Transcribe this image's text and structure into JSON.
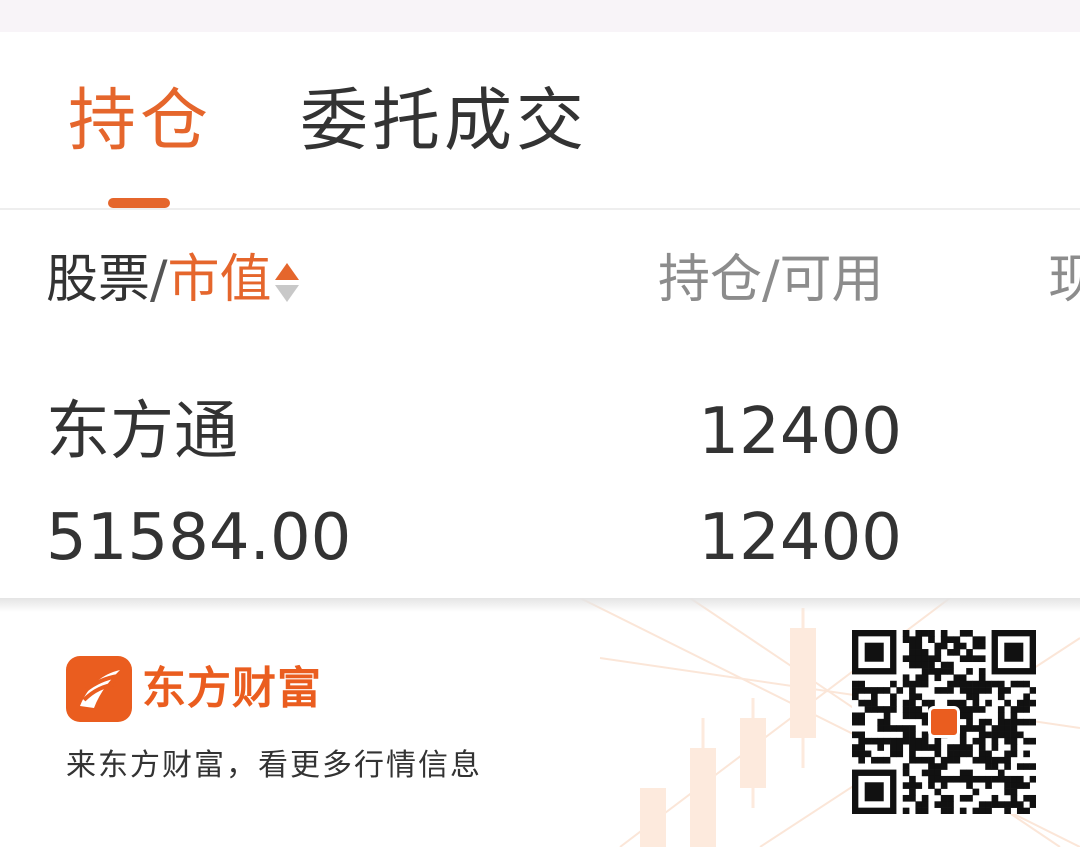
{
  "colors": {
    "accent": "#e5662c",
    "brand": "#ea5d1f",
    "text_primary": "#333333",
    "text_secondary": "#8c8c8c"
  },
  "tabs": [
    {
      "label": "持仓",
      "active": true
    },
    {
      "label": "委托成交",
      "active": false
    }
  ],
  "table": {
    "headers": {
      "stock": "股票",
      "separator": "/",
      "market_value": "市值",
      "sort_icon": "sort-asc-desc-icon",
      "quantity": "持仓/可用",
      "next_column_partial": "现"
    },
    "rows": [
      {
        "stock_name": "东方通",
        "market_value": "51584.00",
        "position": "12400",
        "available": "12400"
      }
    ]
  },
  "footer": {
    "brand_icon": "eastmoney-logo-icon",
    "brand_name": "东方财富",
    "slogan": "来东方财富，看更多行情信息",
    "qr_icon": "qr-code-icon"
  }
}
